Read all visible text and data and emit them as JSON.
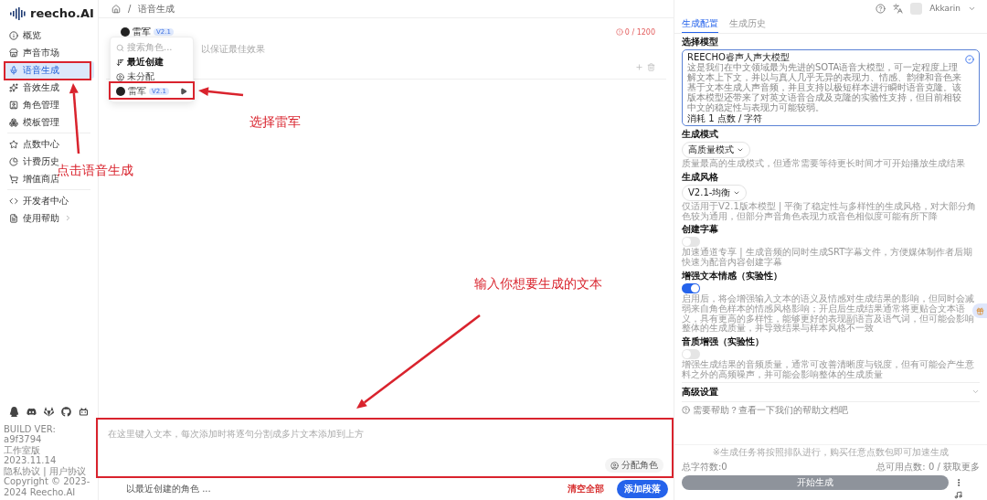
{
  "logo": {
    "text": "reecho.AI"
  },
  "sidebar": {
    "groups": [
      [
        {
          "label": "概览",
          "selected": false,
          "expandable": false
        },
        {
          "label": "声音市场",
          "selected": false,
          "expandable": false
        },
        {
          "label": "语音生成",
          "selected": true,
          "expandable": false
        },
        {
          "label": "音效生成",
          "selected": false,
          "expandable": false
        },
        {
          "label": "角色管理",
          "selected": false,
          "expandable": false
        },
        {
          "label": "模板管理",
          "selected": false,
          "expandable": false
        }
      ],
      [
        {
          "label": "点数中心",
          "selected": false,
          "expandable": false
        },
        {
          "label": "计费历史",
          "selected": false,
          "expandable": false
        },
        {
          "label": "增值商店",
          "selected": false,
          "expandable": false
        }
      ],
      [
        {
          "label": "开发者中心",
          "selected": false,
          "expandable": false
        },
        {
          "label": "使用帮助",
          "selected": false,
          "expandable": true
        }
      ]
    ],
    "build_info": [
      "BUILD VER: a9f3794",
      "工作室版 2023.11.14",
      "隐私协议 | 用户协议",
      "Copyright © 2023-2024 Reecho.AI"
    ]
  },
  "breadcrumb": {
    "separator": "/",
    "items": [
      "语音生成"
    ]
  },
  "segment": {
    "role": {
      "name": "雷军",
      "version": "V2.1"
    },
    "counter": "0 / 1200",
    "hint": "以保证最佳效果"
  },
  "role_menu": {
    "search_placeholder": "搜索角色...",
    "items": [
      {
        "kind": "sort",
        "label": "最近创建"
      },
      {
        "kind": "unassigned",
        "label": "未分配"
      },
      {
        "kind": "role",
        "label": "雷军",
        "version": "V2.1"
      }
    ]
  },
  "editor": {
    "placeholder": "在这里键入文本，每次添加时将逐句分割成多片文本添加到上方",
    "assign_button": "分配角色"
  },
  "footer": {
    "default_role": "以最近创建的角色 ...",
    "clear_button": "清空全部",
    "add_button": "添加段落"
  },
  "header_right": {
    "user": "Akkarin"
  },
  "panel": {
    "tabs": [
      {
        "label": "生成配置",
        "selected": true
      },
      {
        "label": "生成历史",
        "selected": false
      }
    ],
    "sections": [
      {
        "kind": "model",
        "title": "选择模型",
        "card": {
          "name": "REECHO睿声人声大模型",
          "description": "这是我们在中文领域最为先进的SOTA语音大模型，可一定程度上理解文本上下文，并以与真人几乎无异的表现力、情感、韵律和音色来基于文本生成人声音频，并且支持以极短样本进行瞬时语音克隆。该版本模型还带来了对英文语音合成及克隆的实验性支持，但目前相较中文的稳定性与表现力可能较弱。",
          "cost": "消耗 1 点数 / 字符",
          "selected": true
        }
      },
      {
        "kind": "select",
        "title": "生成模式",
        "value": "高质量模式",
        "hint": "质量最高的生成模式，但通常需要等待更长时间才可开始播放生成结果"
      },
      {
        "kind": "select",
        "title": "生成风格",
        "value": "V2.1-均衡",
        "hint": "仅适用于V2.1版本模型 | 平衡了稳定性与多样性的生成风格，对大部分角色较为通用，但部分声音角色表现力或音色相似度可能有所下降"
      },
      {
        "kind": "toggle",
        "title": "创建字幕",
        "on": false,
        "hint": "加速通道专享 | 生成音频的同时生成SRT字幕文件，方便媒体制作者后期快速为配音内容创建字幕"
      },
      {
        "kind": "toggle",
        "title": "增强文本情感（实验性）",
        "on": true,
        "hint": "启用后，将会增强输入文本的语义及情感对生成结果的影响，但同时会减弱来自角色样本的情感风格影响；开启后生成结果通常将更贴合文本语义，具有更高的多样性，能够更好的表现副语言及语气词，但可能会影响整体的生成质量，并导致结果与样本风格不一致"
      },
      {
        "kind": "toggle",
        "title": "音质增强（实验性）",
        "on": false,
        "hint": "增强生成结果的音频质量，通常可改善清晰度与锐度，但有可能会产生意料之外的高频噪声，并可能会影响整体的生成质量"
      }
    ],
    "advanced": {
      "title": "高级设置",
      "expanded": false
    },
    "help": "需要帮助？查看一下我们的帮助文档吧",
    "queue_note": "※生成任务将按照排队进行，购买任意点数包即可加速生成",
    "char_count": "总字符数:0",
    "points": "总可用点数: 0 / 获取更多",
    "start_button": {
      "label": "开始生成",
      "disabled": true
    }
  },
  "annotations": [
    {
      "text": "点击语音生成"
    },
    {
      "text": "选择雷军"
    },
    {
      "text": "输入你想要生成的文本"
    }
  ]
}
